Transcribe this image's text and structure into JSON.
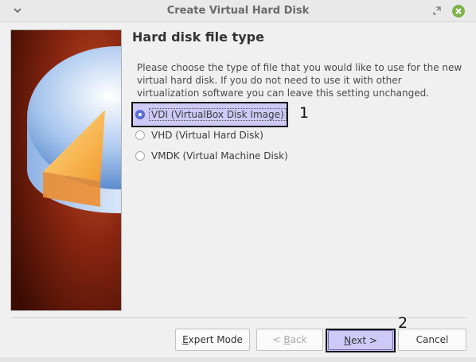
{
  "window": {
    "title": "Create Virtual Hard Disk"
  },
  "page": {
    "heading": "Hard disk file type",
    "description": "Please choose the type of file that you would like to use for the new virtual hard disk. If you do not need to use it with other virtualization software you can leave this setting unchanged."
  },
  "options": [
    {
      "label": "VDI (VirtualBox Disk Image)",
      "selected": true
    },
    {
      "label": "VHD (Virtual Hard Disk)",
      "selected": false
    },
    {
      "label": "VMDK (Virtual Machine Disk)",
      "selected": false
    }
  ],
  "annotations": {
    "step1": "1",
    "step2": "2"
  },
  "buttons": {
    "expert_mode": {
      "prefix": "",
      "mnemonic": "E",
      "rest": "xpert Mode"
    },
    "back": {
      "prefix": "< ",
      "mnemonic": "B",
      "rest": "ack"
    },
    "next": {
      "prefix": "",
      "mnemonic": "N",
      "rest": "ext >"
    },
    "cancel": "Cancel"
  },
  "colors": {
    "accent": "#5c73d6",
    "highlight": "#b4aaff",
    "close_button": "#7fb349"
  },
  "icons": {
    "title_menu": "chevron-down-icon",
    "restore": "restore-icon",
    "close": "close-icon"
  }
}
